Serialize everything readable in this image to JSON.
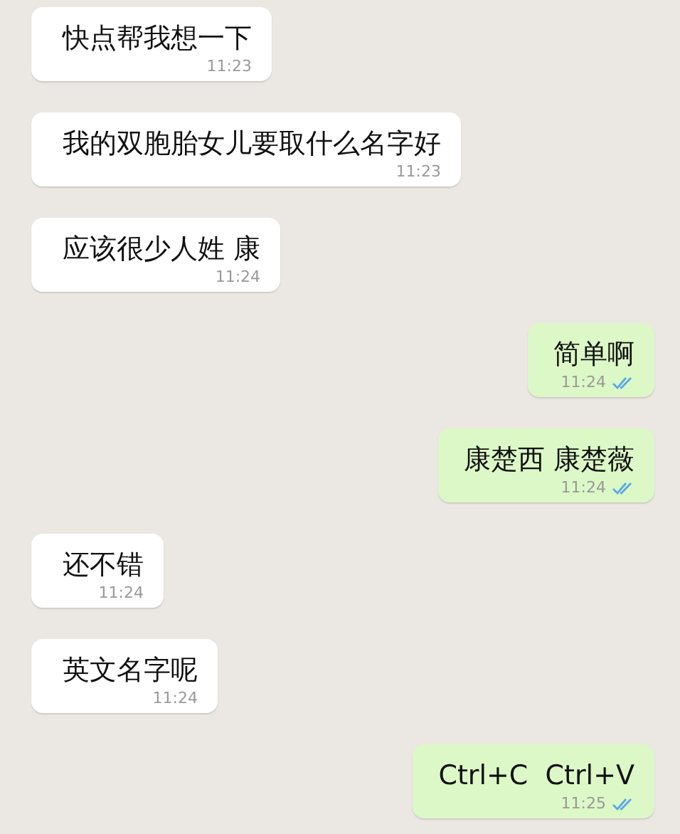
{
  "messages": [
    {
      "kind": "incoming",
      "text": "快点帮我想一下",
      "time": "11:23"
    },
    {
      "kind": "incoming",
      "text": "我的双胞胎女儿要取什么名字好",
      "time": "11:23"
    },
    {
      "kind": "incoming",
      "text": "应该很少人姓 康",
      "time": "11:24"
    },
    {
      "kind": "outgoing",
      "text": "简单啊",
      "time": "11:24",
      "read": true
    },
    {
      "kind": "outgoing",
      "text": "康楚西 康楚薇",
      "time": "11:24",
      "read": true
    },
    {
      "kind": "incoming",
      "text": "还不错",
      "time": "11:24"
    },
    {
      "kind": "incoming",
      "text": "英文名字呢",
      "time": "11:24"
    },
    {
      "kind": "outgoing",
      "text": "Ctrl+C  Ctrl+V",
      "time": "11:25",
      "read": true
    }
  ]
}
